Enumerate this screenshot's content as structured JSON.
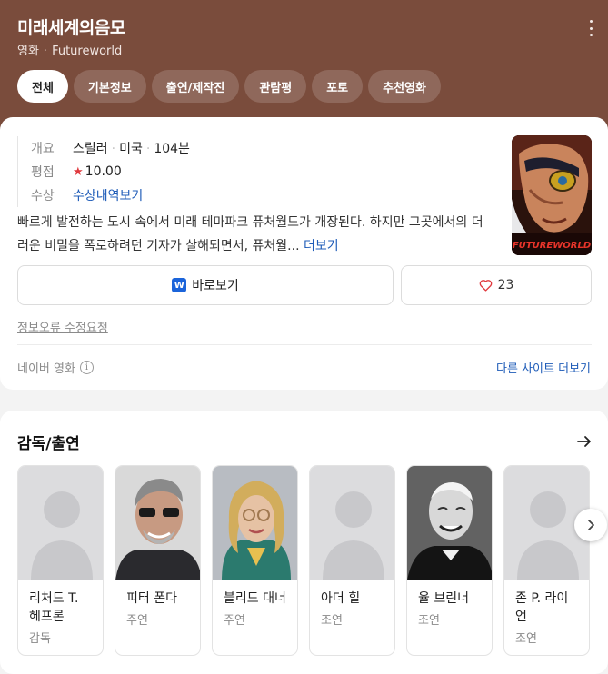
{
  "header": {
    "title": "미래세계의음모",
    "category": "영화",
    "english_title": "Futureworld",
    "bg_color": "#7a4c3c"
  },
  "tabs": [
    {
      "label": "전체",
      "active": true
    },
    {
      "label": "기본정보",
      "active": false
    },
    {
      "label": "출연/제작진",
      "active": false
    },
    {
      "label": "관람평",
      "active": false
    },
    {
      "label": "포토",
      "active": false
    },
    {
      "label": "추천영화",
      "active": false
    }
  ],
  "info": {
    "overview_key": "개요",
    "genre": "스릴러",
    "country": "미국",
    "runtime": "104분",
    "rating_key": "평점",
    "rating": "10.00",
    "awards_key": "수상",
    "awards_link": "수상내역보기"
  },
  "synopsis": {
    "text": "빠르게 발전하는 도시 속에서 미래 테마파크 퓨처월드가 개장된다. 하지만 그곳에서의 더러운 비밀을 폭로하려던 기자가 살해되면서, 퓨처월...",
    "more": "더보기"
  },
  "poster": {
    "caption": "FUTUREWORLD"
  },
  "actions": {
    "watch_label": "바로보기",
    "watch_icon": "W",
    "like_count": "23"
  },
  "report_label": "정보오류 수정요청",
  "source_label": "네이버 영화",
  "more_sites_label": "다른 사이트 더보기",
  "cast_section": {
    "title": "감독/출연",
    "people": [
      {
        "name": "리처드 T. 헤프론",
        "role": "감독",
        "has_photo": false
      },
      {
        "name": "피터 폰다",
        "role": "주연",
        "has_photo": true
      },
      {
        "name": "블리드 대너",
        "role": "주연",
        "has_photo": true
      },
      {
        "name": "아더 힐",
        "role": "조연",
        "has_photo": false
      },
      {
        "name": "율 브린너",
        "role": "조연",
        "has_photo": true
      },
      {
        "name": "존 P. 라이언",
        "role": "조연",
        "has_photo": false
      }
    ]
  },
  "colors": {
    "accent_link": "#1f5cb8",
    "star": "#e0393e"
  }
}
